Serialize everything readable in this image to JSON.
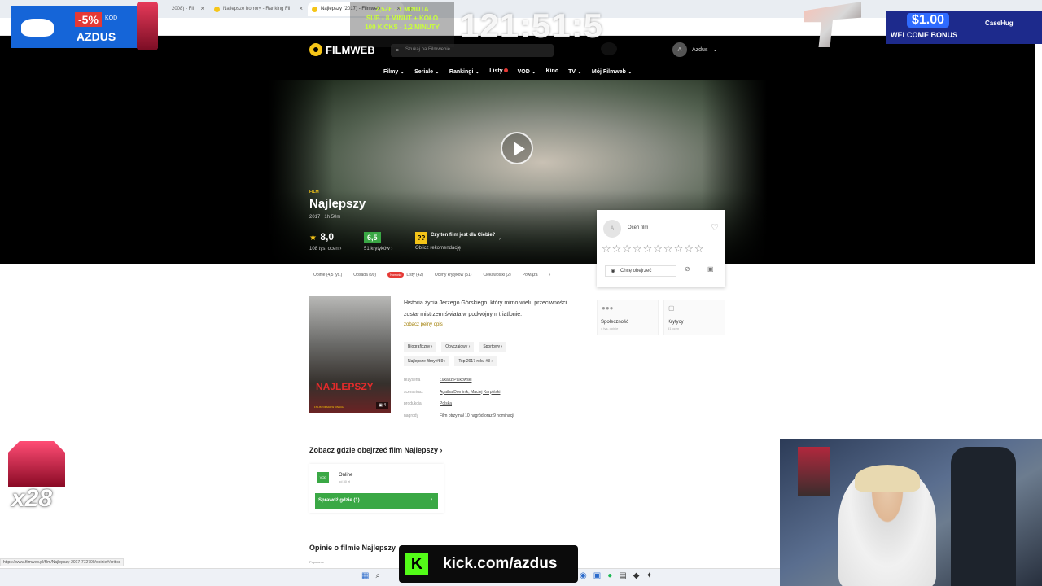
{
  "browser": {
    "tabs": [
      {
        "label": "2008) - Fil",
        "active": false
      },
      {
        "label": "Najlepsze horrory - Ranking Fil",
        "active": false
      },
      {
        "label": "Najlepszy (2017) - Filmweb",
        "active": true
      }
    ],
    "new_tab_label": "+"
  },
  "header": {
    "logo_text": "FILMWEB",
    "search_placeholder": "Szukaj na Filmwebie",
    "user_initial": "A",
    "user_name": "Azdus",
    "nav": [
      "Filmy",
      "Seriale",
      "Rankingi",
      "Listy",
      "VOD",
      "Kino",
      "TV",
      "Mój Filmweb"
    ]
  },
  "film": {
    "tag": "FILM",
    "title": "Najlepszy",
    "year": "2017",
    "duration": "1h 50m",
    "rating": "8,0",
    "rating_count": "108 tys. ocen",
    "critics_score": "6,5",
    "critics_count": "51 krytyków",
    "recommend_q": "??",
    "recommend_title": "Czy ten film jest dla Ciebie?",
    "recommend_sub": "Oblicz rekomendację"
  },
  "rate_card": {
    "avatar": "A",
    "label": "Oceń film",
    "stars": "☆☆☆☆☆☆☆☆☆☆",
    "want_label": "Chcę obejrzeć"
  },
  "subtabs": [
    "Opinie (4,5 tys.)",
    "Obsada (99)",
    "Listy (42)",
    "Oceny krytyków (51)",
    "Ciekawostki (2)",
    "Powiąza"
  ],
  "subtabs_new_badge": "Nowość",
  "content": {
    "poster_title": "NAJLEPSZY",
    "poster_footer": "17 LISTOPADA W KINACH",
    "poster_gallery": "4",
    "description": "Historia życia Jerzego Górskiego, który mimo wielu przeciwności został mistrzem świata w podwójnym triatlonie.",
    "more_link": "zobacz pełny opis",
    "genres": [
      "Biograficzny",
      "Obyczajowy",
      "Sportowy"
    ],
    "rankings": [
      "Najlepsze filmy #89",
      "Top 2017 roku #3"
    ],
    "credits": [
      {
        "k": "reżyseria",
        "v": "Łukasz Palkowski"
      },
      {
        "k": "scenariusz",
        "v": "Agatha Dominik, Maciej Karpiński"
      },
      {
        "k": "produkcja",
        "v": "Polska"
      },
      {
        "k": "nagrody",
        "v": "Film otrzymał 10 nagród oraz 9 nominacji"
      }
    ],
    "community_label": "Społeczność",
    "community_sub": "4 tys. opinie",
    "critics_label": "Krytycy",
    "critics_sub": "51 ocen"
  },
  "where": {
    "title": "Zobacz gdzie obejrzeć film Najlepszy",
    "vod_label": "VOD",
    "online": "Online",
    "price": "od 30 zł",
    "button": "Sprawdź gdzie (1)"
  },
  "opinions": {
    "title": "Opinie o filmie Najlepszy",
    "sub": "Popularne"
  },
  "status_url": "https://www.filmweb.pl/film/Najlepszy-2017-772700/opinie#/critics",
  "overlays": {
    "code_pct": "-5%",
    "code_kod": "KOD",
    "code_name": "AZDUS",
    "sub_lines": [
      "2,5ZŁ - 1 MINUTA",
      "SUB - 8 MINUT + KOŁO",
      "100 KICKS - 1,2 MINUTY"
    ],
    "timer": "121:51:5",
    "bonus_amount": "$1.00",
    "bonus_text": "WELCOME BONUS",
    "bonus_brand": "CaseHug",
    "multiplier": "x28",
    "kick_text": "kick.com/azdus"
  }
}
